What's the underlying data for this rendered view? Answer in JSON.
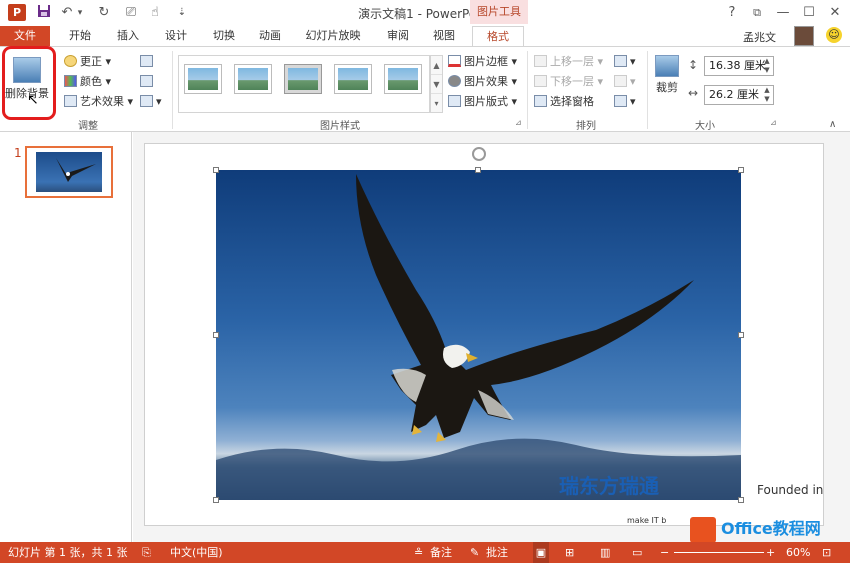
{
  "titlebar": {
    "app_icon": "P",
    "qat": {
      "save": "save-icon",
      "undo": "↶",
      "undo_arrow": "▾",
      "redo": "↻",
      "present": "⎚",
      "touch": "☝",
      "more": "⇣"
    },
    "title": "演示文稿1 - PowerPoint",
    "context_tab": "图片工具",
    "help": "?",
    "restore_ribbon": "⧉",
    "minimize": "—",
    "maximize": "☐",
    "close": "✕"
  },
  "tabs": {
    "file": "文件",
    "items": [
      "开始",
      "插入",
      "设计",
      "切换",
      "动画",
      "幻灯片放映",
      "审阅",
      "视图"
    ],
    "active": "格式",
    "user": "孟兆文",
    "smiley": "☺"
  },
  "ribbon": {
    "adjust": {
      "remove_bg": "删除背景",
      "corrections": "更正",
      "color": "颜色",
      "artistic": "艺术效果",
      "label": "调整"
    },
    "styles": {
      "border": "图片边框",
      "effects": "图片效果",
      "layout": "图片版式",
      "label": "图片样式"
    },
    "arrange": {
      "bring_forward": "上移一层",
      "send_backward": "下移一层",
      "selection_pane": "选择窗格",
      "label": "排列"
    },
    "size": {
      "crop": "裁剪",
      "height": "16.38 厘米",
      "width": "26.2 厘米",
      "label": "大小"
    }
  },
  "thumbnails": {
    "slide_number": "1"
  },
  "watermark": {
    "ruilogo": "瑞东方瑞通",
    "slogan": "make IT b",
    "founded": "Founded in",
    "office": "Office教程网"
  },
  "status": {
    "slide_info": "幻灯片 第 1 张，共 1 张",
    "language": "中文(中国)",
    "notes": "备注",
    "comments": "批注",
    "zoom": "60%"
  }
}
